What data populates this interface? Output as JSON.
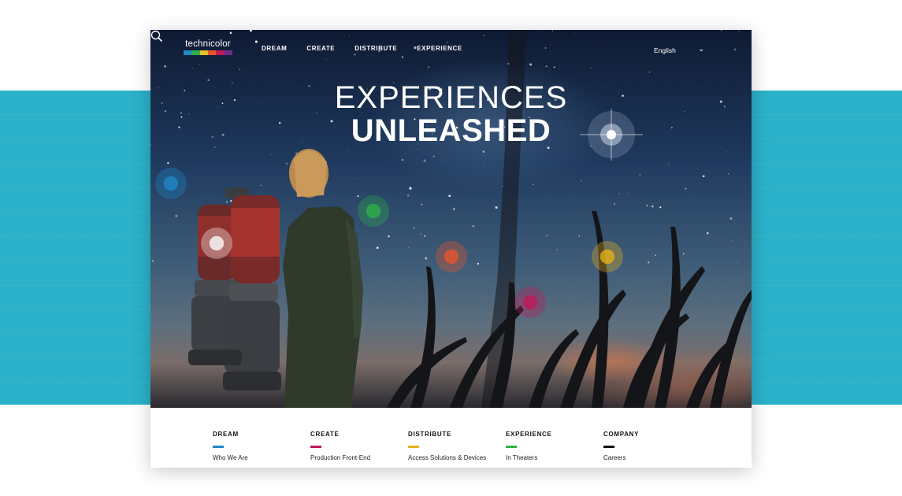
{
  "brand": {
    "name": "technicolor",
    "bar_colors": [
      "#1e88c8",
      "#2fb04a",
      "#e8c12a",
      "#e8552a",
      "#c0185a",
      "#6a2d8f"
    ]
  },
  "nav": {
    "items": [
      "DREAM",
      "CREATE",
      "DISTRIBUTE",
      "EXPERIENCE"
    ]
  },
  "language": {
    "selected": "English"
  },
  "icons": {
    "language_toggle": "chevron-down-icon",
    "search": "search-icon"
  },
  "hero": {
    "headline_top": "EXPERIENCES",
    "headline_bottom": "UNLEASHED",
    "hotspot_colors": [
      "#1e88c8",
      "#ffffff",
      "#2fb04a",
      "#e8552a",
      "#c0185a",
      "#e8b21a"
    ]
  },
  "footer": {
    "columns": [
      {
        "heading": "DREAM",
        "accent": "#1e88c8",
        "link": "Who We Are"
      },
      {
        "heading": "CREATE",
        "accent": "#c0185a",
        "link": "Production Front-End"
      },
      {
        "heading": "DISTRIBUTE",
        "accent": "#e8b21a",
        "link": "Access Solutions & Devices"
      },
      {
        "heading": "EXPERIENCE",
        "accent": "#2fb04a",
        "link": "In Theaters"
      },
      {
        "heading": "COMPANY",
        "accent": "#111111",
        "link": "Careers"
      }
    ]
  },
  "background": {
    "band_color": "#2bb1c9"
  }
}
